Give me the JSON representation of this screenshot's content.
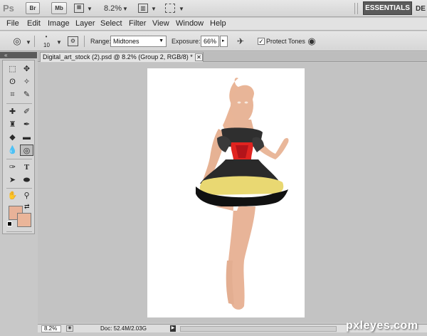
{
  "app": {
    "logo": "Ps",
    "bridge_label": "Br",
    "minibridge_label": "Mb",
    "zoom": "8.2%",
    "workspace": "ESSENTIALS",
    "workspace_next": "DE"
  },
  "menu": [
    "File",
    "Edit",
    "Image",
    "Layer",
    "Select",
    "Filter",
    "View",
    "Window",
    "Help"
  ],
  "options": {
    "brush_size": "10",
    "range_label": "Range:",
    "range_value": "Midtones",
    "exposure_label": "Exposure:",
    "exposure_value": "66%",
    "protect_label": "Protect Tones",
    "protect_checked": "✓"
  },
  "panel": {
    "collapse": "«"
  },
  "document": {
    "tab_title": "Digital_art_stock (2).psd @ 8.2% (Group 2, RGB/8) *",
    "close": "✕"
  },
  "colors": {
    "foreground": "#e8b298",
    "background": "#eab599"
  },
  "status": {
    "zoom": "8.2%",
    "doc_info": "Doc: 52.4M/2.03G"
  },
  "watermark": "pxleyes.com"
}
